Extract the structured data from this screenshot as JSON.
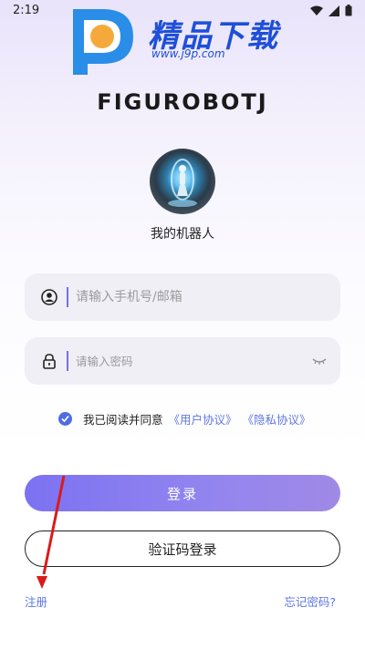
{
  "status_bar": {
    "time": "2:19"
  },
  "watermark": {
    "title": "精品下载",
    "url": "www.j9p.com"
  },
  "brand": {
    "name": "FIGUROBOTJ"
  },
  "profile": {
    "name": "我的机器人"
  },
  "form": {
    "account_placeholder": "请输入手机号/邮箱",
    "password_placeholder": "请输入密码"
  },
  "agreement": {
    "prefix": "我已阅读并同意",
    "user_agreement": "《用户协议》",
    "privacy_agreement": "《隐私协议》"
  },
  "buttons": {
    "login": "登录",
    "code_login": "验证码登录"
  },
  "footer": {
    "register": "注册",
    "forgot_password": "忘记密码?"
  },
  "colors": {
    "accent": "#7c72f2",
    "link": "#5d76e6",
    "watermark": "#1e4fd8"
  }
}
